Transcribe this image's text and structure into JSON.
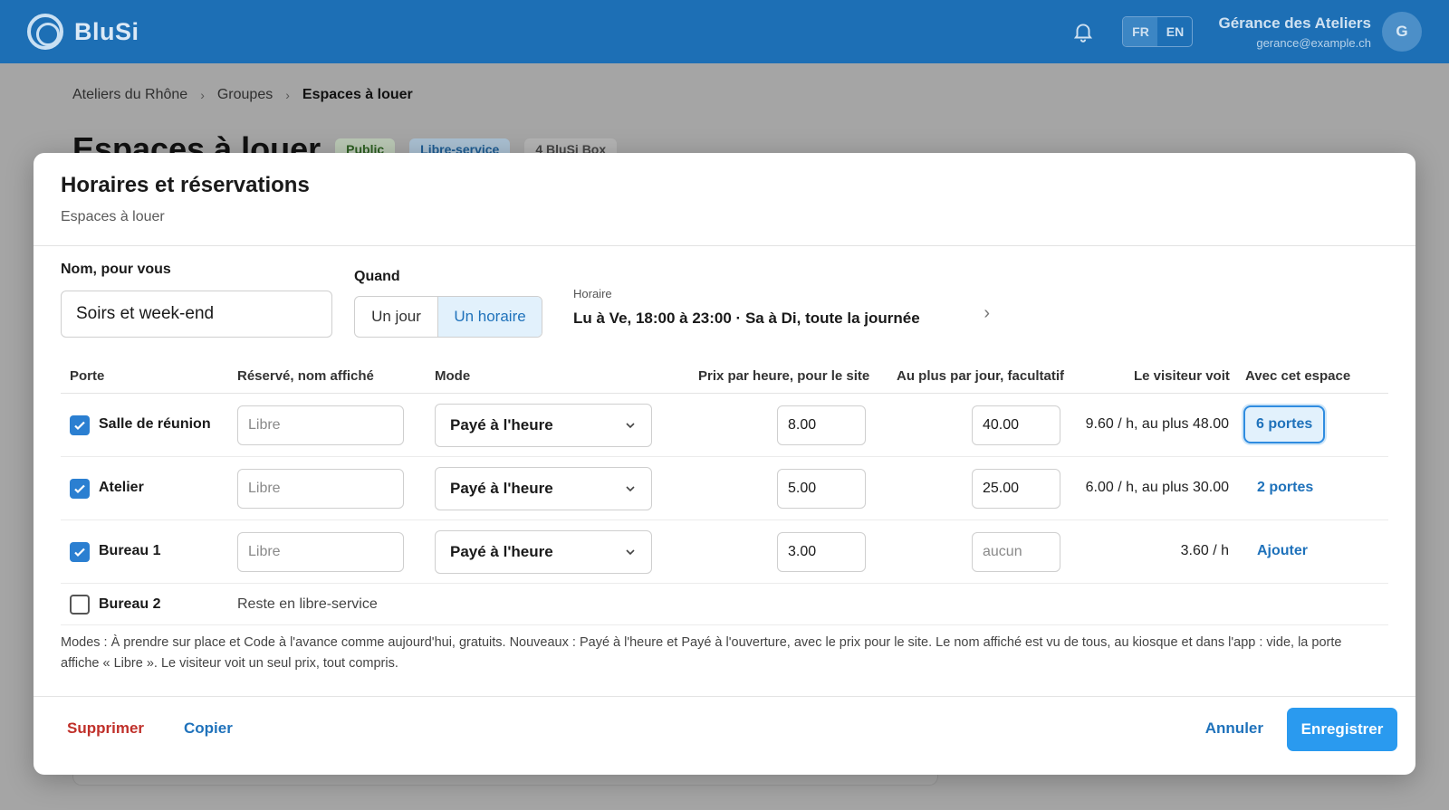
{
  "app": {
    "name": "BluSi"
  },
  "header": {
    "languages": [
      "FR",
      "EN"
    ],
    "active_language": "FR",
    "user_name": "Gérance des Ateliers",
    "user_email": "gerance@example.ch",
    "avatar_initial": "G"
  },
  "breadcrumb": [
    "Ateliers du Rhône",
    "Groupes",
    "Espaces à louer"
  ],
  "background_page": {
    "title": "Espaces à louer",
    "badges": [
      "Public",
      "Libre-service",
      "4 BluSi Box"
    ]
  },
  "modal": {
    "title": "Horaires et réservations",
    "subtitle": "Espaces à louer",
    "name_label": "Nom, pour vous",
    "name_value": "Soirs et week-end",
    "quand_label": "Quand",
    "quand_options": [
      "Un jour",
      "Un horaire"
    ],
    "quand_selected": "Un horaire",
    "horaire_label": "Horaire",
    "horaire_value": "Lu à Ve, 18:00 à 23:00 · Sa à Di, toute la journée",
    "columns": [
      "Porte",
      "Réservé, nom affiché",
      "Mode",
      "Prix par heure, pour le site",
      "Au plus par jour, facultatif",
      "Le visiteur voit",
      "Avec cet espace"
    ],
    "rows": [
      {
        "checked": true,
        "name": "Salle de réunion",
        "reserved_placeholder": "Libre",
        "mode": "Payé à l'heure",
        "price": "8.00",
        "max_per_day": "40.00",
        "max_placeholder": "aucun",
        "visitor_sees": "9.60 / h, au plus 48.00",
        "with_space": "6 portes"
      },
      {
        "checked": true,
        "name": "Atelier",
        "reserved_placeholder": "Libre",
        "mode": "Payé à l'heure",
        "price": "5.00",
        "max_per_day": "25.00",
        "max_placeholder": "aucun",
        "visitor_sees": "6.00 / h, au plus 30.00",
        "with_space": "2 portes"
      },
      {
        "checked": true,
        "name": "Bureau 1",
        "reserved_placeholder": "Libre",
        "mode": "Payé à l'heure",
        "price": "3.00",
        "max_per_day": "",
        "max_placeholder": "aucun",
        "visitor_sees": "3.60 / h",
        "with_space": "Ajouter"
      },
      {
        "checked": false,
        "name": "Bureau 2",
        "note": "Reste en libre-service"
      }
    ],
    "note": "Modes : À prendre sur place et Code à l'avance comme aujourd'hui, gratuits. Nouveaux : Payé à l'heure et Payé à l'ouverture, avec le prix pour le site. Le nom affiché est vu de tous, au kiosque et dans l'app : vide, la porte affiche « Libre ». Le visiteur voit un seul prix, tout compris.",
    "footer": {
      "delete_label": "Supprimer",
      "copy_label": "Copier",
      "cancel_label": "Annuler",
      "save_label": "Enregistrer"
    }
  },
  "colors": {
    "topbar": "#1d6fb5",
    "accent": "#1f72bb",
    "primary_button": "#2a9aef",
    "danger": "#c0302a"
  },
  "icons": [
    "logo-icon",
    "bell-icon",
    "chevron-right-icon",
    "chevron-down-icon",
    "check-icon"
  ]
}
